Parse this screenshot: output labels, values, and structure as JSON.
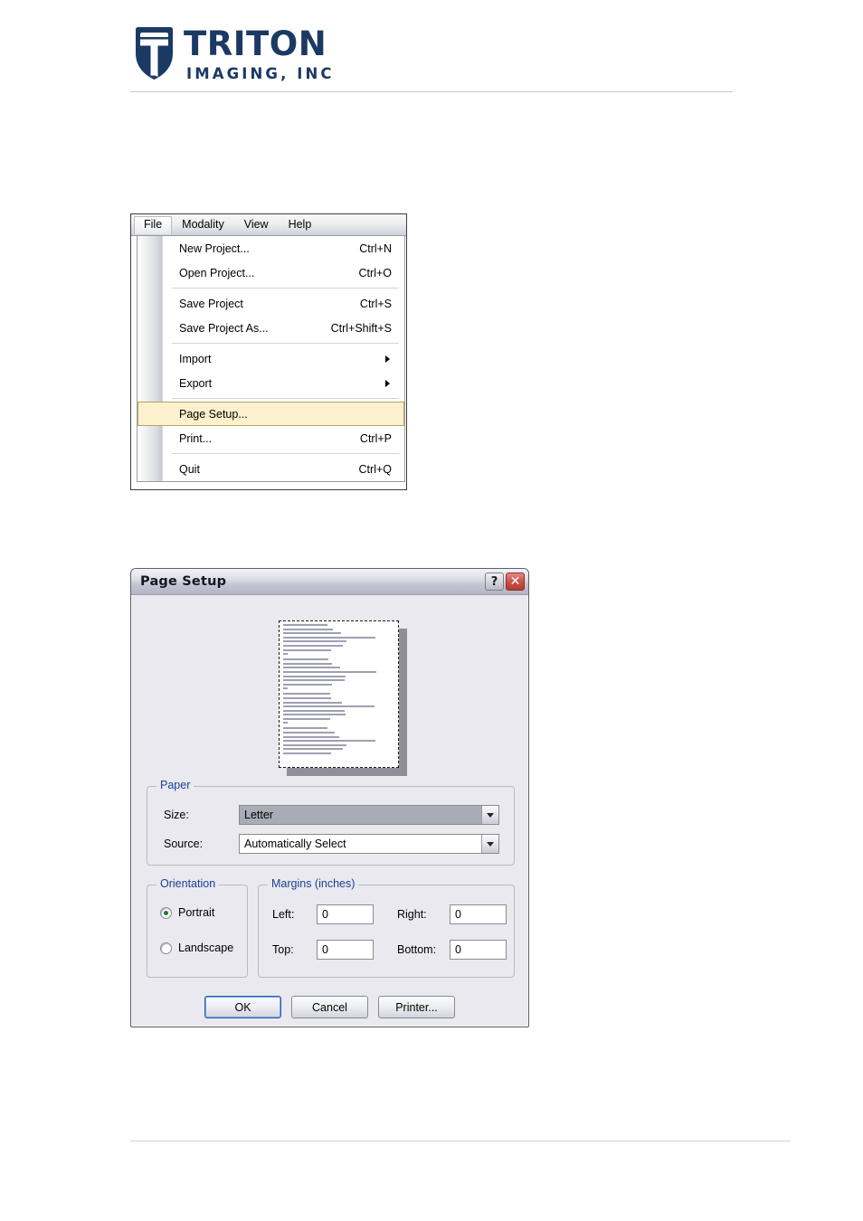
{
  "header": {
    "brand_name": "TRITON",
    "brand_tagline": "IMAGING, INC",
    "logo_icon": "triton-shield-icon",
    "brand_color": "#1b3a63"
  },
  "menu_screenshot": {
    "menubar": [
      {
        "label": "File",
        "active": true
      },
      {
        "label": "Modality",
        "active": false
      },
      {
        "label": "View",
        "active": false
      },
      {
        "label": "Help",
        "active": false
      }
    ],
    "file_menu": {
      "items": [
        {
          "label": "New Project...",
          "accel": "Ctrl+N",
          "type": "item"
        },
        {
          "label": "Open Project...",
          "accel": "Ctrl+O",
          "type": "item"
        },
        {
          "type": "separator"
        },
        {
          "label": "Save Project",
          "accel": "Ctrl+S",
          "type": "item"
        },
        {
          "label": "Save Project As...",
          "accel": "Ctrl+Shift+S",
          "type": "item"
        },
        {
          "type": "separator"
        },
        {
          "label": "Import",
          "accel": "",
          "type": "submenu"
        },
        {
          "label": "Export",
          "accel": "",
          "type": "submenu"
        },
        {
          "type": "separator"
        },
        {
          "label": "Page Setup...",
          "accel": "",
          "type": "item",
          "highlighted": true
        },
        {
          "label": "Print...",
          "accel": "Ctrl+P",
          "type": "item"
        },
        {
          "type": "separator"
        },
        {
          "label": "Quit",
          "accel": "Ctrl+Q",
          "type": "item"
        }
      ],
      "highlight_color": "#fdf1cd",
      "highlight_border_color": "#b6a36b"
    }
  },
  "page_setup_dialog": {
    "title": "Page Setup",
    "help_button_label": "?",
    "close_button_label": "✕",
    "preview": {
      "icon": "page-preview-thumbnail",
      "orientation": "portrait"
    },
    "paper": {
      "group_label": "Paper",
      "size_label": "Size:",
      "size_value": "Letter",
      "source_label": "Source:",
      "source_value": "Automatically Select"
    },
    "orientation": {
      "group_label": "Orientation",
      "options": [
        {
          "label": "Portrait",
          "selected": true
        },
        {
          "label": "Landscape",
          "selected": false
        }
      ],
      "selected_dot_color": "#1f7a2e"
    },
    "margins": {
      "group_label": "Margins (inches)",
      "left_label": "Left:",
      "left_value": "0",
      "right_label": "Right:",
      "right_value": "0",
      "top_label": "Top:",
      "top_value": "0",
      "bottom_label": "Bottom:",
      "bottom_value": "0"
    },
    "buttons": [
      {
        "label": "OK",
        "default": true
      },
      {
        "label": "Cancel",
        "default": false
      },
      {
        "label": "Printer...",
        "default": false
      }
    ],
    "group_title_color": "#1c3f94"
  }
}
